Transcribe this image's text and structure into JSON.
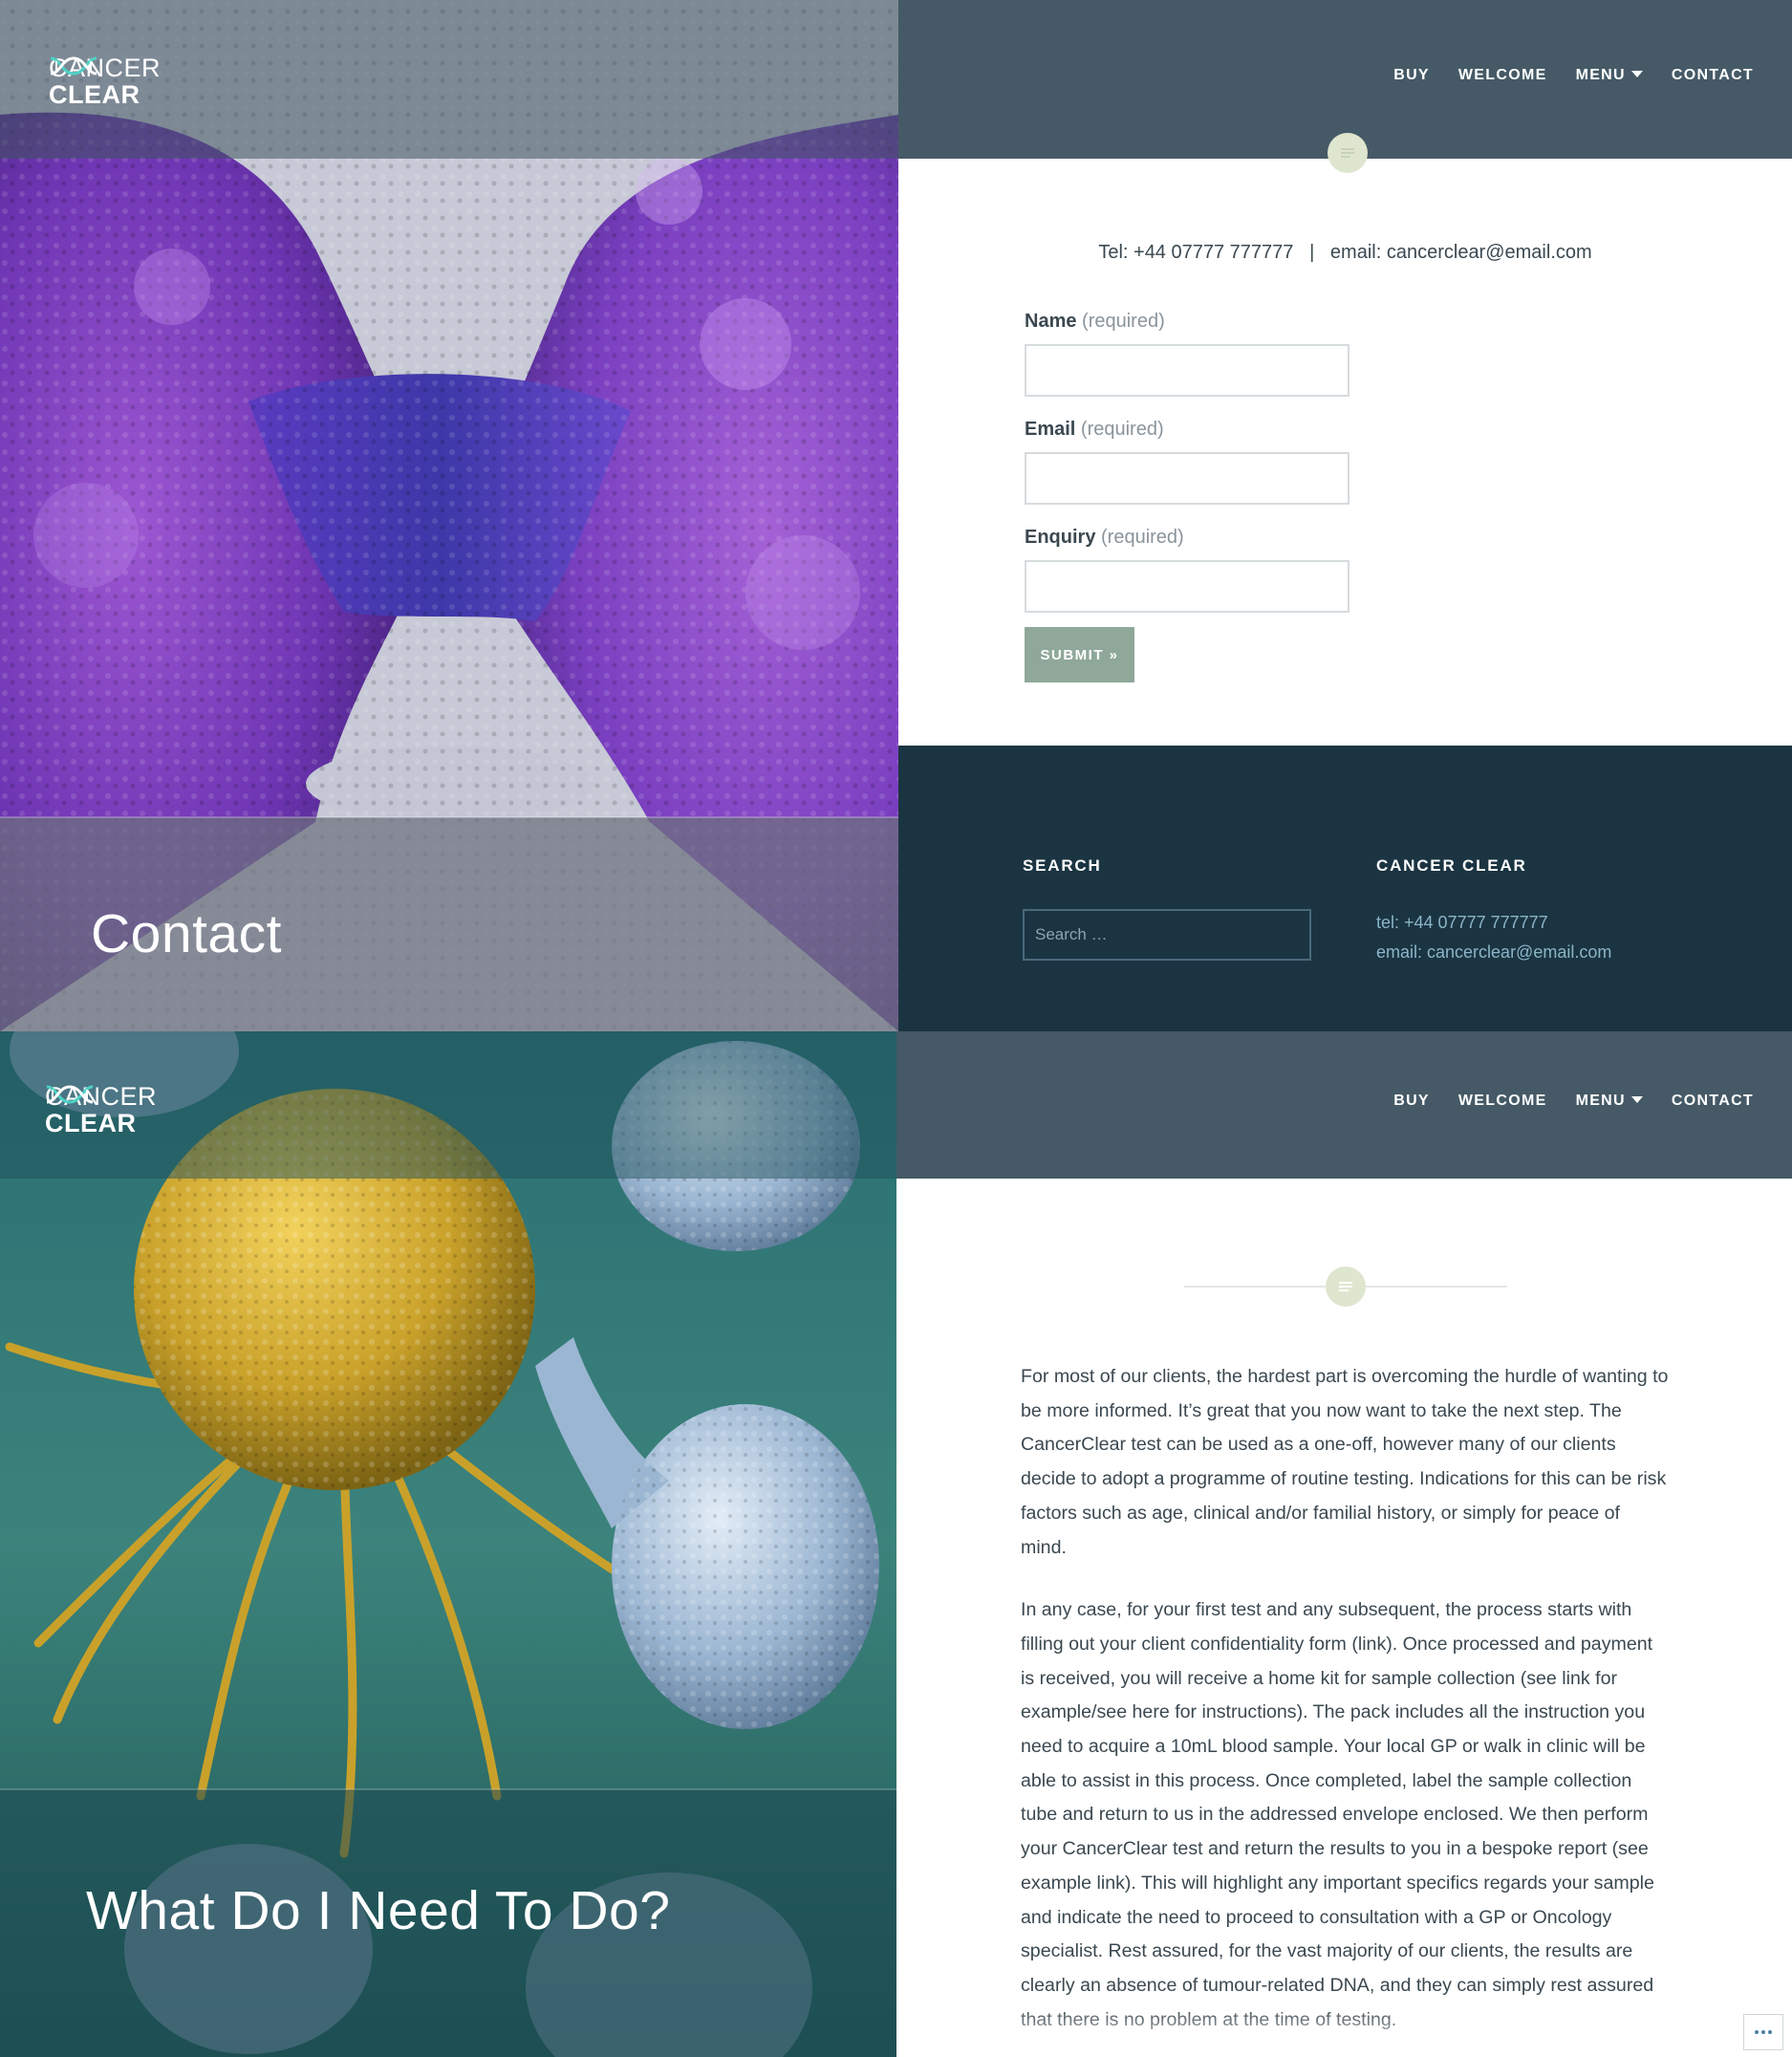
{
  "site": {
    "logo_line1": "CANCER",
    "logo_line2": "CLEAR"
  },
  "nav": {
    "items": [
      {
        "label": "BUY"
      },
      {
        "label": "WELCOME"
      },
      {
        "label": "MENU"
      },
      {
        "label": "CONTACT"
      }
    ]
  },
  "contact_page": {
    "title": "Contact",
    "contact_line": "Tel: +44 07777 777777   |   email: cancerclear@email.com",
    "form": {
      "name_label": "Name",
      "email_label": "Email",
      "enquiry_label": "Enquiry",
      "required_text": "(required)",
      "submit_label": "SUBMIT »"
    }
  },
  "footer": {
    "search_heading": "SEARCH",
    "search_placeholder": "Search …",
    "brand_heading": "CANCER CLEAR",
    "tel": "tel: +44 07777 777777",
    "email": "email: cancerclear@email.com"
  },
  "article_page": {
    "title": "What Do I Need To Do?",
    "paragraph1": "For most of our clients, the hardest part is overcoming the hurdle of wanting to be more informed. It’s great that you now want to take the next step. The CancerClear test can be used as a one-off, however many of our clients decide to adopt a programme of routine testing. Indications for this can be risk factors such as age, clinical and/or familial history, or simply for peace of mind.",
    "paragraph2": "In any case, for your first test and any subsequent, the process starts with filling out your client confidentiality form (link). Once processed and payment is received, you will receive a home kit for sample collection (see link for example/see here for instructions). The pack includes all the instruction you need to acquire a 10mL blood sample. Your local GP or walk in clinic will be able to assist in this process. Once completed, label the sample collection tube and return to us in the addressed envelope enclosed. We then perform your CancerClear test and return the results to you in a bespoke report (see example link). This will highlight any important specifics regards your sample and indicate the need to proceed to consultation with a GP or Oncology specialist. Rest assured, for the vast majority of our clients, the results are clearly an absence of tumour-related DNA, and they can simply rest assured that there is no problem at the time of testing."
  },
  "colors": {
    "header_bar": "#455a66",
    "footer_bg": "#1b3442",
    "accent_button": "#8fa89a",
    "link": "#8bb5c7"
  }
}
